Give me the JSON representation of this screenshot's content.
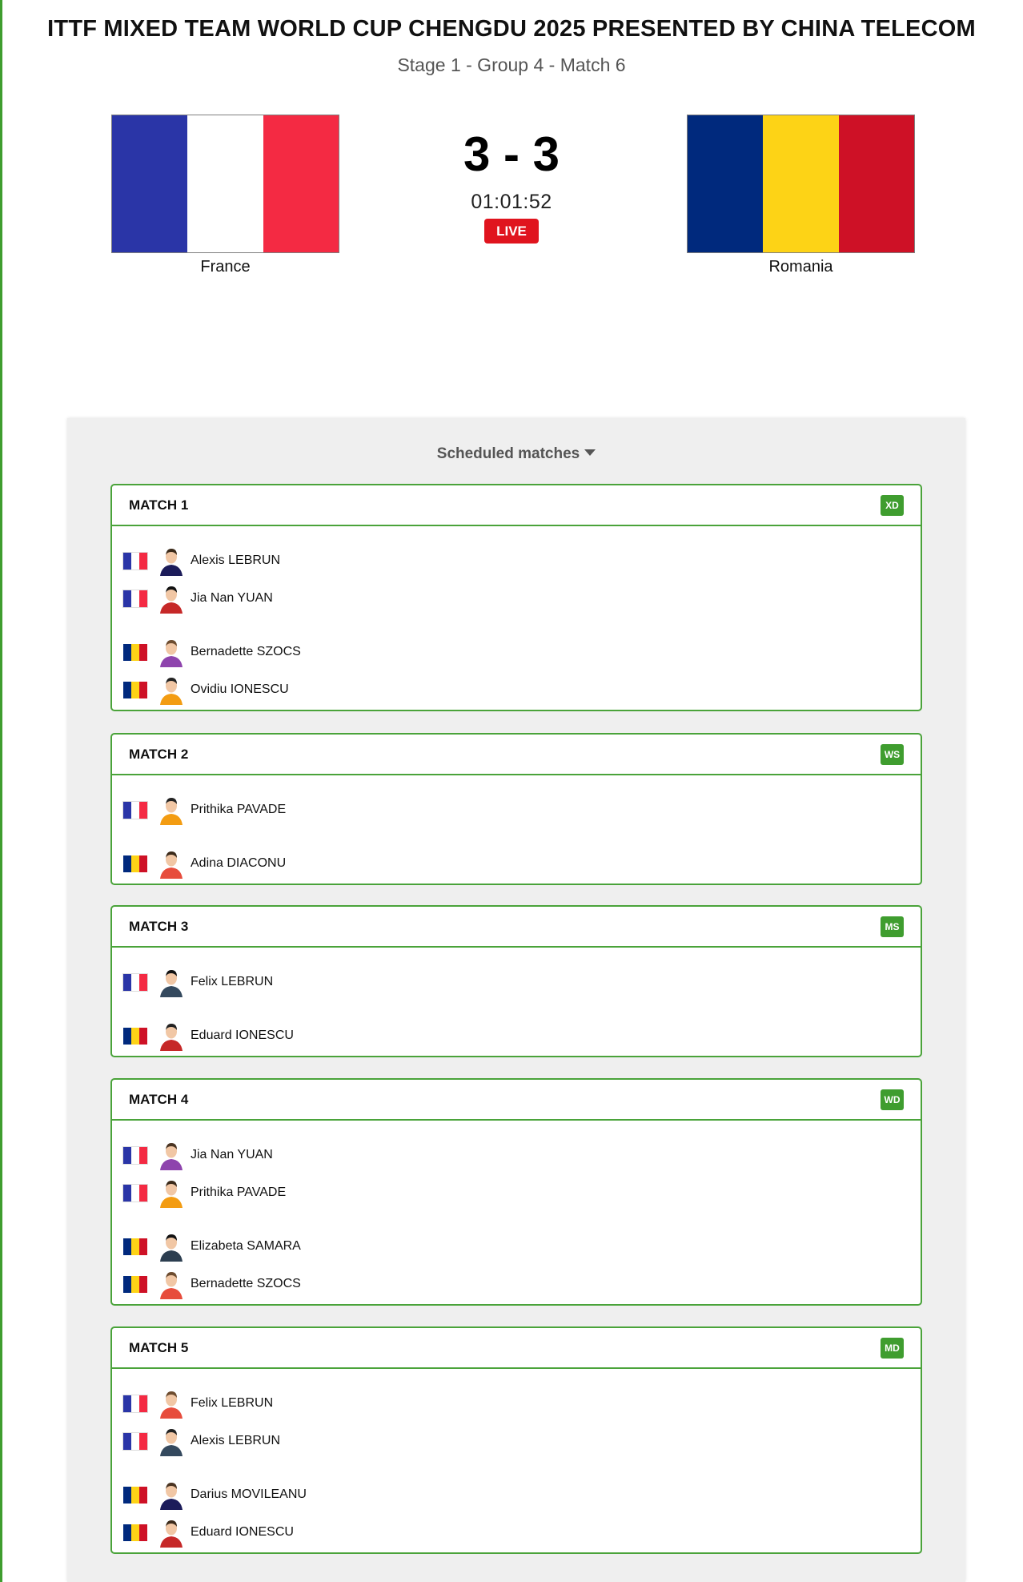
{
  "header": {
    "event_title": "ITTF MIXED TEAM WORLD CUP CHENGDU 2025 PRESENTED BY CHINA TELECOM",
    "stage": "Stage 1 - Group 4 - Match 6"
  },
  "teams": {
    "home": {
      "name": "France",
      "flag_colors": [
        "#2a35a7",
        "#ffffff",
        "#f42a43"
      ]
    },
    "away": {
      "name": "Romania",
      "flag_colors": [
        "#00297d",
        "#fdd316",
        "#ce1126"
      ]
    }
  },
  "score": {
    "text": "3 - 3",
    "clock": "01:01:52",
    "status": "LIVE"
  },
  "colors": {
    "accent_green": "#4aa33a",
    "live_red": "#e0141e",
    "badge_green": "#3f9d2f"
  },
  "scheduled": {
    "label": "Scheduled matches",
    "icon": "caret-down-icon"
  },
  "matches": [
    {
      "title": "MATCH 1",
      "type": "XD",
      "home_players": [
        "Alexis LEBRUN",
        "Jia Nan YUAN"
      ],
      "away_players": [
        "Bernadette SZOCS",
        "Ovidiu IONESCU"
      ]
    },
    {
      "title": "MATCH 2",
      "type": "WS",
      "home_players": [
        "Prithika PAVADE"
      ],
      "away_players": [
        "Adina DIACONU"
      ]
    },
    {
      "title": "MATCH 3",
      "type": "MS",
      "home_players": [
        "Felix LEBRUN"
      ],
      "away_players": [
        "Eduard IONESCU"
      ]
    },
    {
      "title": "MATCH 4",
      "type": "WD",
      "home_players": [
        "Jia Nan YUAN",
        "Prithika PAVADE"
      ],
      "away_players": [
        "Elizabeta SAMARA",
        "Bernadette SZOCS"
      ]
    },
    {
      "title": "MATCH 5",
      "type": "MD",
      "home_players": [
        "Felix LEBRUN",
        "Alexis LEBRUN"
      ],
      "away_players": [
        "Darius MOVILEANU",
        "Eduard IONESCU"
      ]
    }
  ]
}
